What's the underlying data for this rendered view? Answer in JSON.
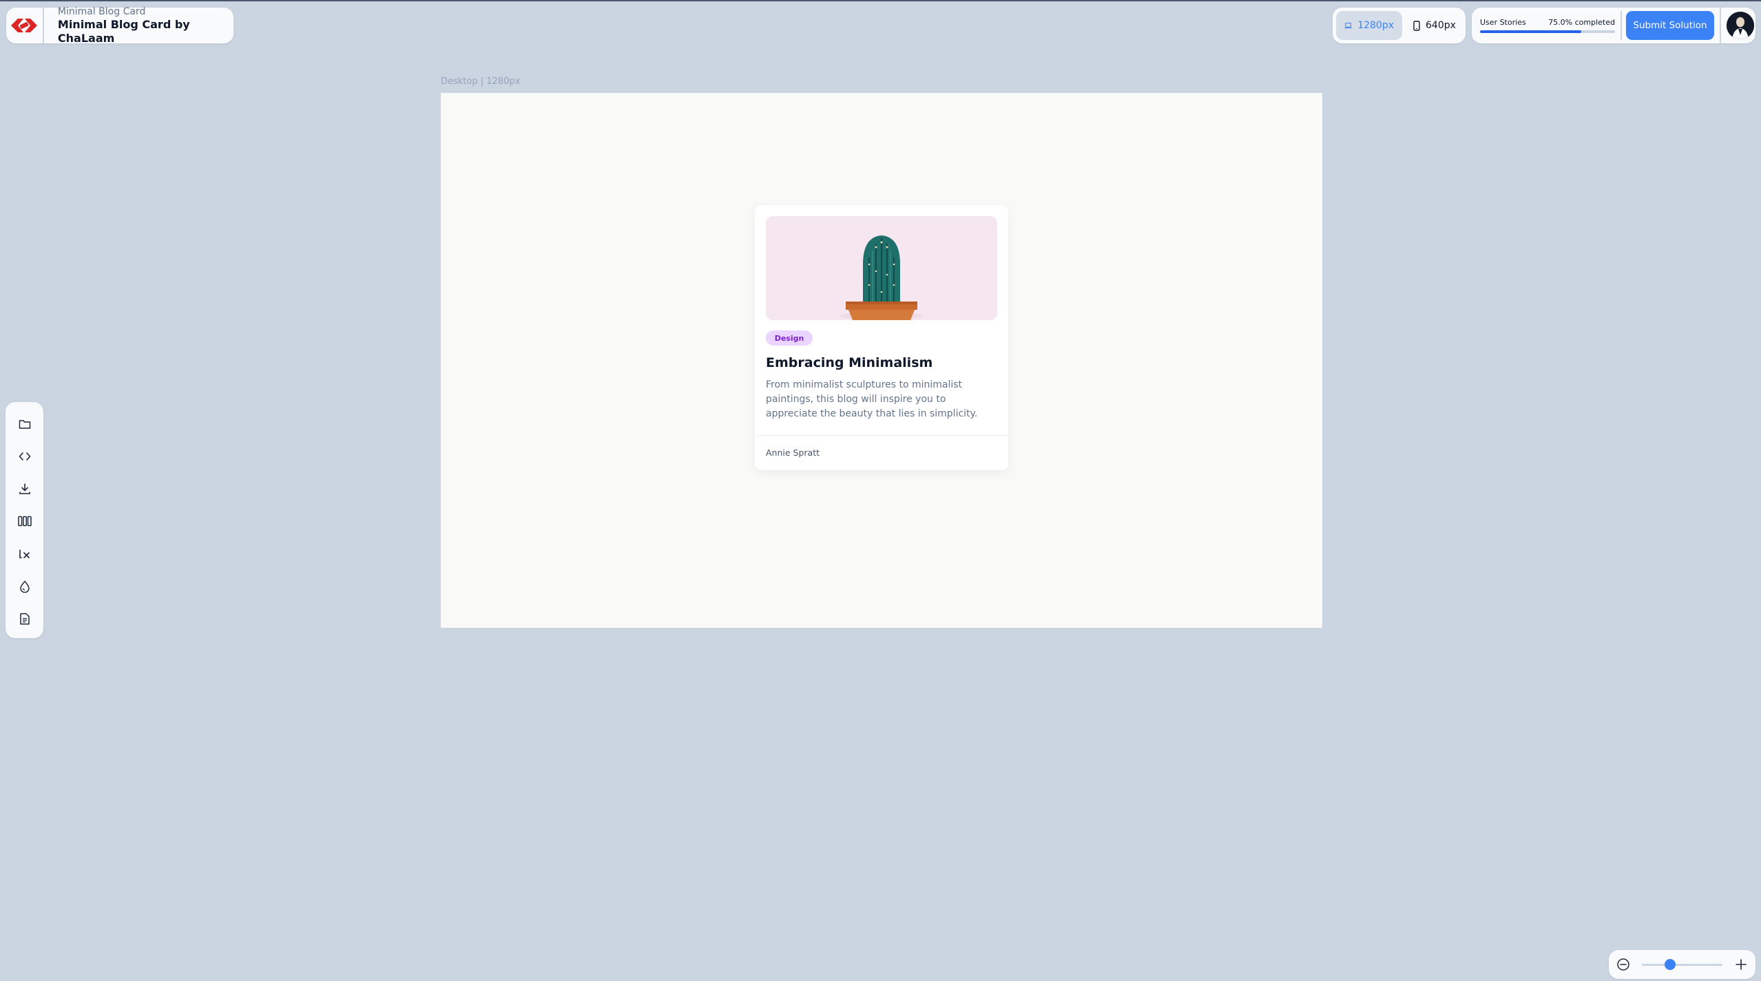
{
  "header": {
    "subtitle": "Minimal Blog Card",
    "title": "Minimal Blog Card by ChaLaam",
    "logo_icon": "brand-logo-icon"
  },
  "viewport": {
    "desktop_label": "1280px",
    "mobile_label": "640px",
    "active": "desktop"
  },
  "stories": {
    "label": "User Stories",
    "percent_text": "75.0% completed",
    "progress": 0.75
  },
  "actions": {
    "submit_label": "Submit Solution"
  },
  "sidebar": {
    "items": [
      {
        "icon": "folder-icon"
      },
      {
        "icon": "code-icon"
      },
      {
        "icon": "download-icon"
      },
      {
        "icon": "columns-icon"
      },
      {
        "icon": "lx-icon"
      },
      {
        "icon": "drop-icon"
      },
      {
        "icon": "document-icon"
      }
    ]
  },
  "canvas": {
    "frame_label": "Desktop | 1280px"
  },
  "card": {
    "tag": "Design",
    "title": "Embracing Minimalism",
    "description": "From minimalist sculptures to minimalist paintings, this blog will inspire you to appreciate the beauty that lies in simplicity.",
    "author": "Annie Spratt"
  },
  "zoom": {
    "level": 0.35
  },
  "colors": {
    "background": "#cbd5e1",
    "accent": "#3b82f6",
    "tag_bg": "#e9d5ff",
    "tag_text": "#7e22ce"
  }
}
